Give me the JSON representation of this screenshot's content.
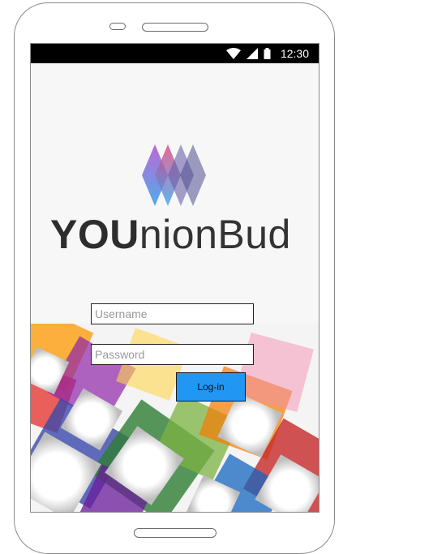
{
  "status_bar": {
    "time": "12:30",
    "icons": [
      "wifi-icon",
      "signal-icon",
      "battery-icon"
    ]
  },
  "logo": {
    "text_bold": "YOU",
    "text_light": "nionBud"
  },
  "login_form": {
    "username_placeholder": "Username",
    "password_placeholder": "Password",
    "login_label": "Log-in"
  },
  "colors": {
    "login_button": "#2196f3",
    "status_bar": "#000000",
    "screen_background": "#f7f7f7"
  }
}
